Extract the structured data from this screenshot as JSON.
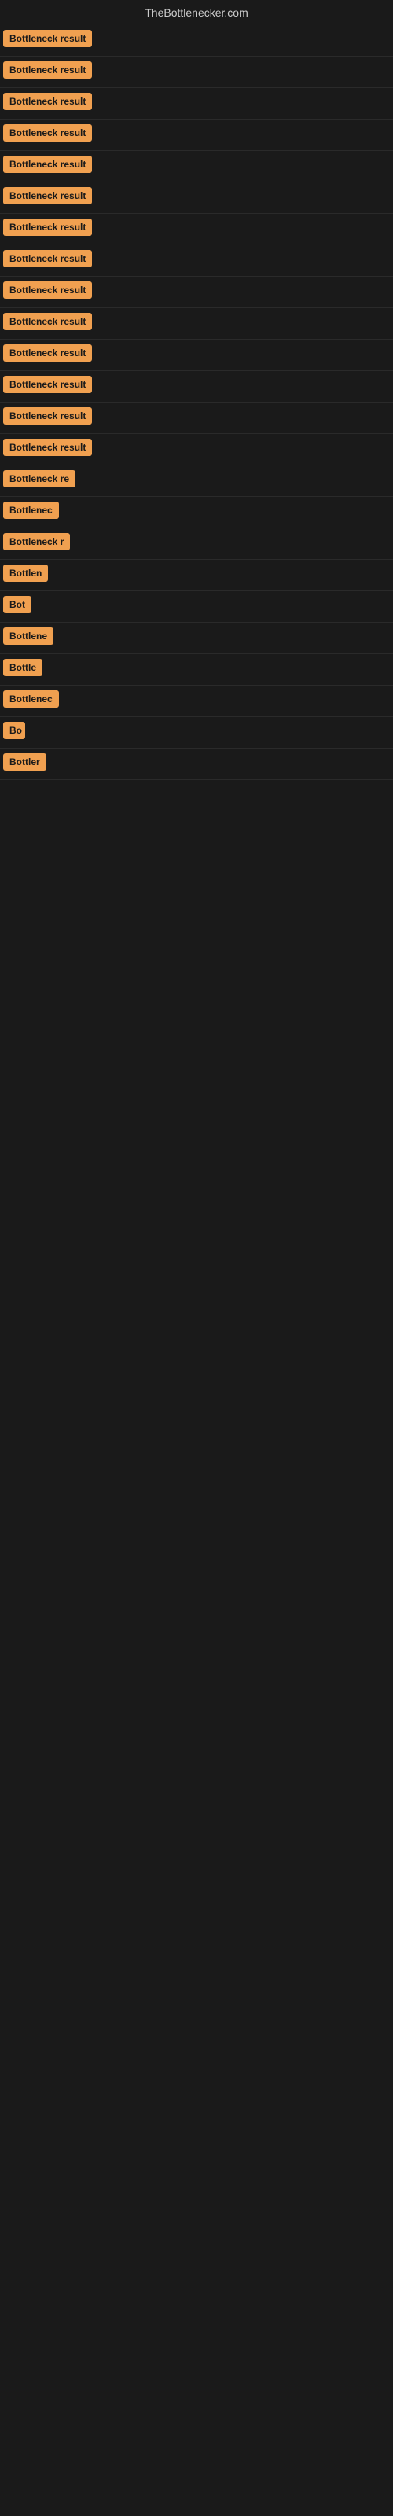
{
  "site": {
    "title": "TheBottlenecker.com"
  },
  "rows": [
    {
      "id": 1,
      "label": "Bottleneck result",
      "width": 130
    },
    {
      "id": 2,
      "label": "Bottleneck result",
      "width": 130
    },
    {
      "id": 3,
      "label": "Bottleneck result",
      "width": 130
    },
    {
      "id": 4,
      "label": "Bottleneck result",
      "width": 130
    },
    {
      "id": 5,
      "label": "Bottleneck result",
      "width": 130
    },
    {
      "id": 6,
      "label": "Bottleneck result",
      "width": 130
    },
    {
      "id": 7,
      "label": "Bottleneck result",
      "width": 130
    },
    {
      "id": 8,
      "label": "Bottleneck result",
      "width": 130
    },
    {
      "id": 9,
      "label": "Bottleneck result",
      "width": 130
    },
    {
      "id": 10,
      "label": "Bottleneck result",
      "width": 130
    },
    {
      "id": 11,
      "label": "Bottleneck result",
      "width": 130
    },
    {
      "id": 12,
      "label": "Bottleneck result",
      "width": 130
    },
    {
      "id": 13,
      "label": "Bottleneck result",
      "width": 130
    },
    {
      "id": 14,
      "label": "Bottleneck result",
      "width": 130
    },
    {
      "id": 15,
      "label": "Bottleneck re",
      "width": 102
    },
    {
      "id": 16,
      "label": "Bottlenec",
      "width": 80
    },
    {
      "id": 17,
      "label": "Bottleneck r",
      "width": 90
    },
    {
      "id": 18,
      "label": "Bottlen",
      "width": 68
    },
    {
      "id": 19,
      "label": "Bot",
      "width": 38
    },
    {
      "id": 20,
      "label": "Bottlene",
      "width": 72
    },
    {
      "id": 21,
      "label": "Bottle",
      "width": 58
    },
    {
      "id": 22,
      "label": "Bottlenec",
      "width": 78
    },
    {
      "id": 23,
      "label": "Bo",
      "width": 28
    },
    {
      "id": 24,
      "label": "Bottler",
      "width": 60
    }
  ],
  "colors": {
    "badge_bg": "#f0a050",
    "badge_text": "#1a1a1a",
    "bg": "#1a1a1a",
    "title": "#cccccc"
  }
}
